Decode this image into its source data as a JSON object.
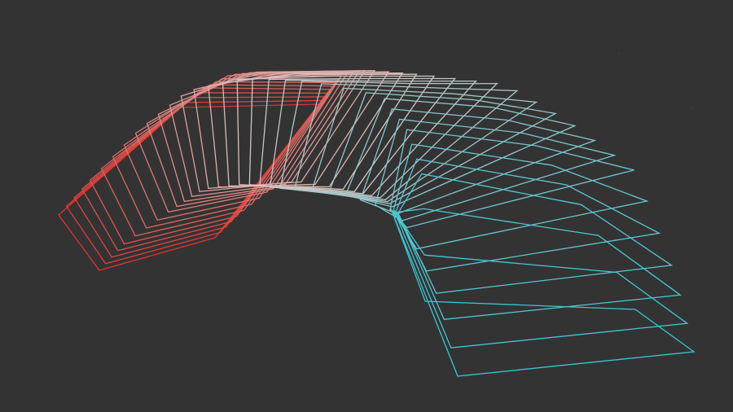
{
  "artwork": {
    "background_color": "#333333",
    "subject": "pentagon-outline-sweep",
    "frame_count": 34,
    "gradient": {
      "start_color": "#e0332d",
      "mid_color": "#d9c7c4",
      "end_color": "#36c7d4"
    }
  }
}
